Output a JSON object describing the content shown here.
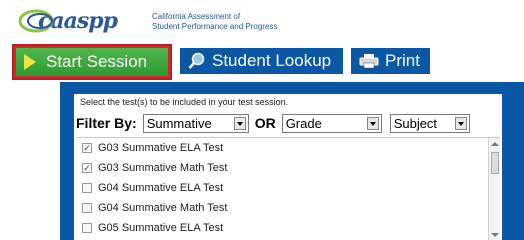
{
  "header": {
    "logo_text": "caaspp",
    "tagline_line1": "California Assessment of",
    "tagline_line2": "Student Performance and Progress"
  },
  "toolbar": {
    "start_session_label": "Start Session",
    "student_lookup_label": "Student Lookup",
    "print_label": "Print"
  },
  "panel": {
    "instruction": "Select the test(s) to be included in your test session.",
    "filter_label": "Filter By:",
    "or_label": "OR",
    "filter_type_value": "Summative",
    "filter_grade_value": "Grade",
    "filter_subject_value": "Subject",
    "tests": [
      {
        "label": "G03 Summative ELA Test",
        "checked": true
      },
      {
        "label": "G03 Summative Math Test",
        "checked": true
      },
      {
        "label": "G04 Summative ELA Test",
        "checked": false
      },
      {
        "label": "G04 Summative Math Test",
        "checked": false
      },
      {
        "label": "G05 Summative ELA Test",
        "checked": false
      }
    ]
  },
  "colors": {
    "accent_blue": "#0a57a6",
    "start_green": "#3aa83a",
    "highlight_red": "#c8232c"
  }
}
